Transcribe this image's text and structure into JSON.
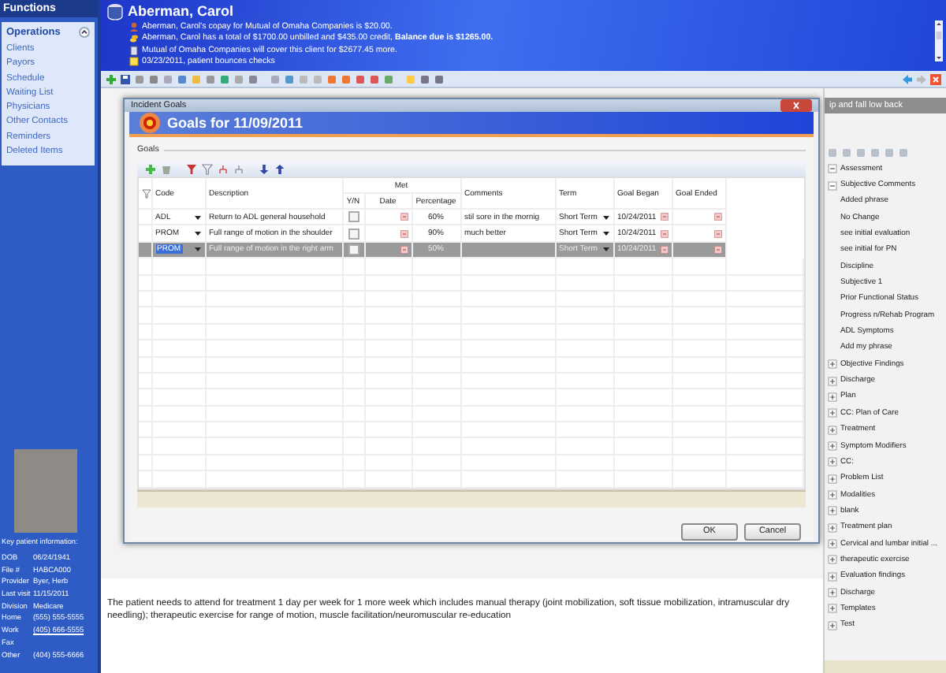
{
  "sidebar": {
    "title": "Functions",
    "section": {
      "title": "Operations",
      "expanded": true,
      "items": [
        "Clients",
        "Payors",
        "Schedule",
        "Waiting List",
        "Physicians",
        "Other Contacts",
        "Reminders",
        "Deleted Items"
      ]
    },
    "key_info": {
      "title": "Key patient information:",
      "fields": [
        {
          "label": "DOB",
          "value": "06/24/1941",
          "link": false
        },
        {
          "label": "File #",
          "value": "HABCA000",
          "link": false
        },
        {
          "label": "Provider",
          "value": "Byer, Herb",
          "link": false
        },
        {
          "label": "Last visit",
          "value": "11/15/2011",
          "link": false
        },
        {
          "label": "Division",
          "value": "Medicare",
          "link": false
        },
        {
          "label": "Home",
          "value": "(555) 555-5555",
          "link": false
        },
        {
          "label": "Work",
          "value": "(405) 666-5555",
          "link": true
        },
        {
          "label": "Fax"
        },
        {
          "label": "Other",
          "value": "(404) 555-6666",
          "link": false
        }
      ]
    }
  },
  "header": {
    "patient_name": "Aberman, Carol",
    "alerts": [
      {
        "kind": "person",
        "text": "Aberman, Carol's copay for Mutual of Omaha Companies is $20.00."
      },
      {
        "kind": "coins",
        "text": "Aberman, Carol has a total of $1700.00 unbilled and $435.00 credit, **Balance due is $1265.00.**"
      },
      {
        "kind": "document",
        "text": "Mutual of Omaha Companies will cover this client for $2677.45 more."
      },
      {
        "kind": "note",
        "text": "03/23/2011, patient bounces checks"
      }
    ]
  },
  "notes": {
    "note_field": "ip and fall low back",
    "plan_text": "The patient needs to attend for treatment 1 day per week for 1 more week which includes manual therapy (joint mobilization, soft tissue mobilization, intramuscular dry needling); therapeutic exercise for range of motion, muscle facilitation/neuromuscular re-education"
  },
  "phrase_tree": [
    {
      "label": "Assessment",
      "expanded": true
    },
    {
      "label": "Subjective Comments",
      "expanded": true,
      "children": [
        {
          "label": "Added phrase"
        },
        {
          "label": "No Change"
        },
        {
          "label": "see initial evaluation"
        },
        {
          "label": "see initial for PN"
        },
        {
          "label": "Discipline"
        },
        {
          "label": "Subjective 1"
        },
        {
          "label": "Prior Functional Status"
        },
        {
          "label": "Progress n/Rehab Program"
        },
        {
          "label": "ADL Symptoms"
        },
        {
          "label": "Add my phrase"
        }
      ]
    },
    {
      "label": "Objective Findings",
      "expanded": false
    },
    {
      "label": "Discharge",
      "expanded": false
    },
    {
      "label": "Plan",
      "expanded": false
    },
    {
      "label": "CC: Plan of Care",
      "expanded": false
    },
    {
      "label": "Treatment",
      "expanded": false
    },
    {
      "label": "Symptom Modifiers",
      "expanded": false
    },
    {
      "label": "CC:",
      "expanded": false
    },
    {
      "label": "Problem List",
      "expanded": false
    },
    {
      "label": "Modalities",
      "expanded": false
    },
    {
      "label": "blank",
      "expanded": false
    },
    {
      "label": "Treatment plan",
      "expanded": false
    },
    {
      "label": "Cervical and lumbar initial ...",
      "expanded": false
    },
    {
      "label": "therapeutic exercise",
      "expanded": false
    },
    {
      "label": "Evaluation findings",
      "expanded": false
    },
    {
      "label": "Discharge",
      "expanded": false
    },
    {
      "label": "Templates",
      "expanded": false
    },
    {
      "label": "Test",
      "expanded": false
    }
  ],
  "dialog": {
    "window_title": "Incident Goals",
    "heading": "Goals for 11/09/2011",
    "group_label": "Goals",
    "column_group": "Met",
    "columns": [
      "Code",
      "Description",
      "Y/N",
      "Date",
      "Percentage",
      "Comments",
      "Term",
      "Goal Began",
      "Goal Ended"
    ],
    "rows": [
      {
        "code": "ADL",
        "description": "Return to ADL general household",
        "met": false,
        "percentage": "60%",
        "comments": "stil sore in the mornig",
        "term": "Short Term",
        "goal_began": "10/24/2011",
        "selected": false
      },
      {
        "code": "PROM",
        "description": "Full range of motion in the shoulder",
        "met": false,
        "percentage": "90%",
        "comments": "much better",
        "term": "Short Term",
        "goal_began": "10/24/2011",
        "selected": false
      },
      {
        "code": "PROM",
        "description": "Full range of motion in the right arm",
        "met": false,
        "percentage": "50%",
        "comments": "",
        "term": "Short Term",
        "goal_began": "10/24/2011",
        "selected": true
      }
    ],
    "buttons": [
      "OK",
      "Cancel"
    ]
  }
}
